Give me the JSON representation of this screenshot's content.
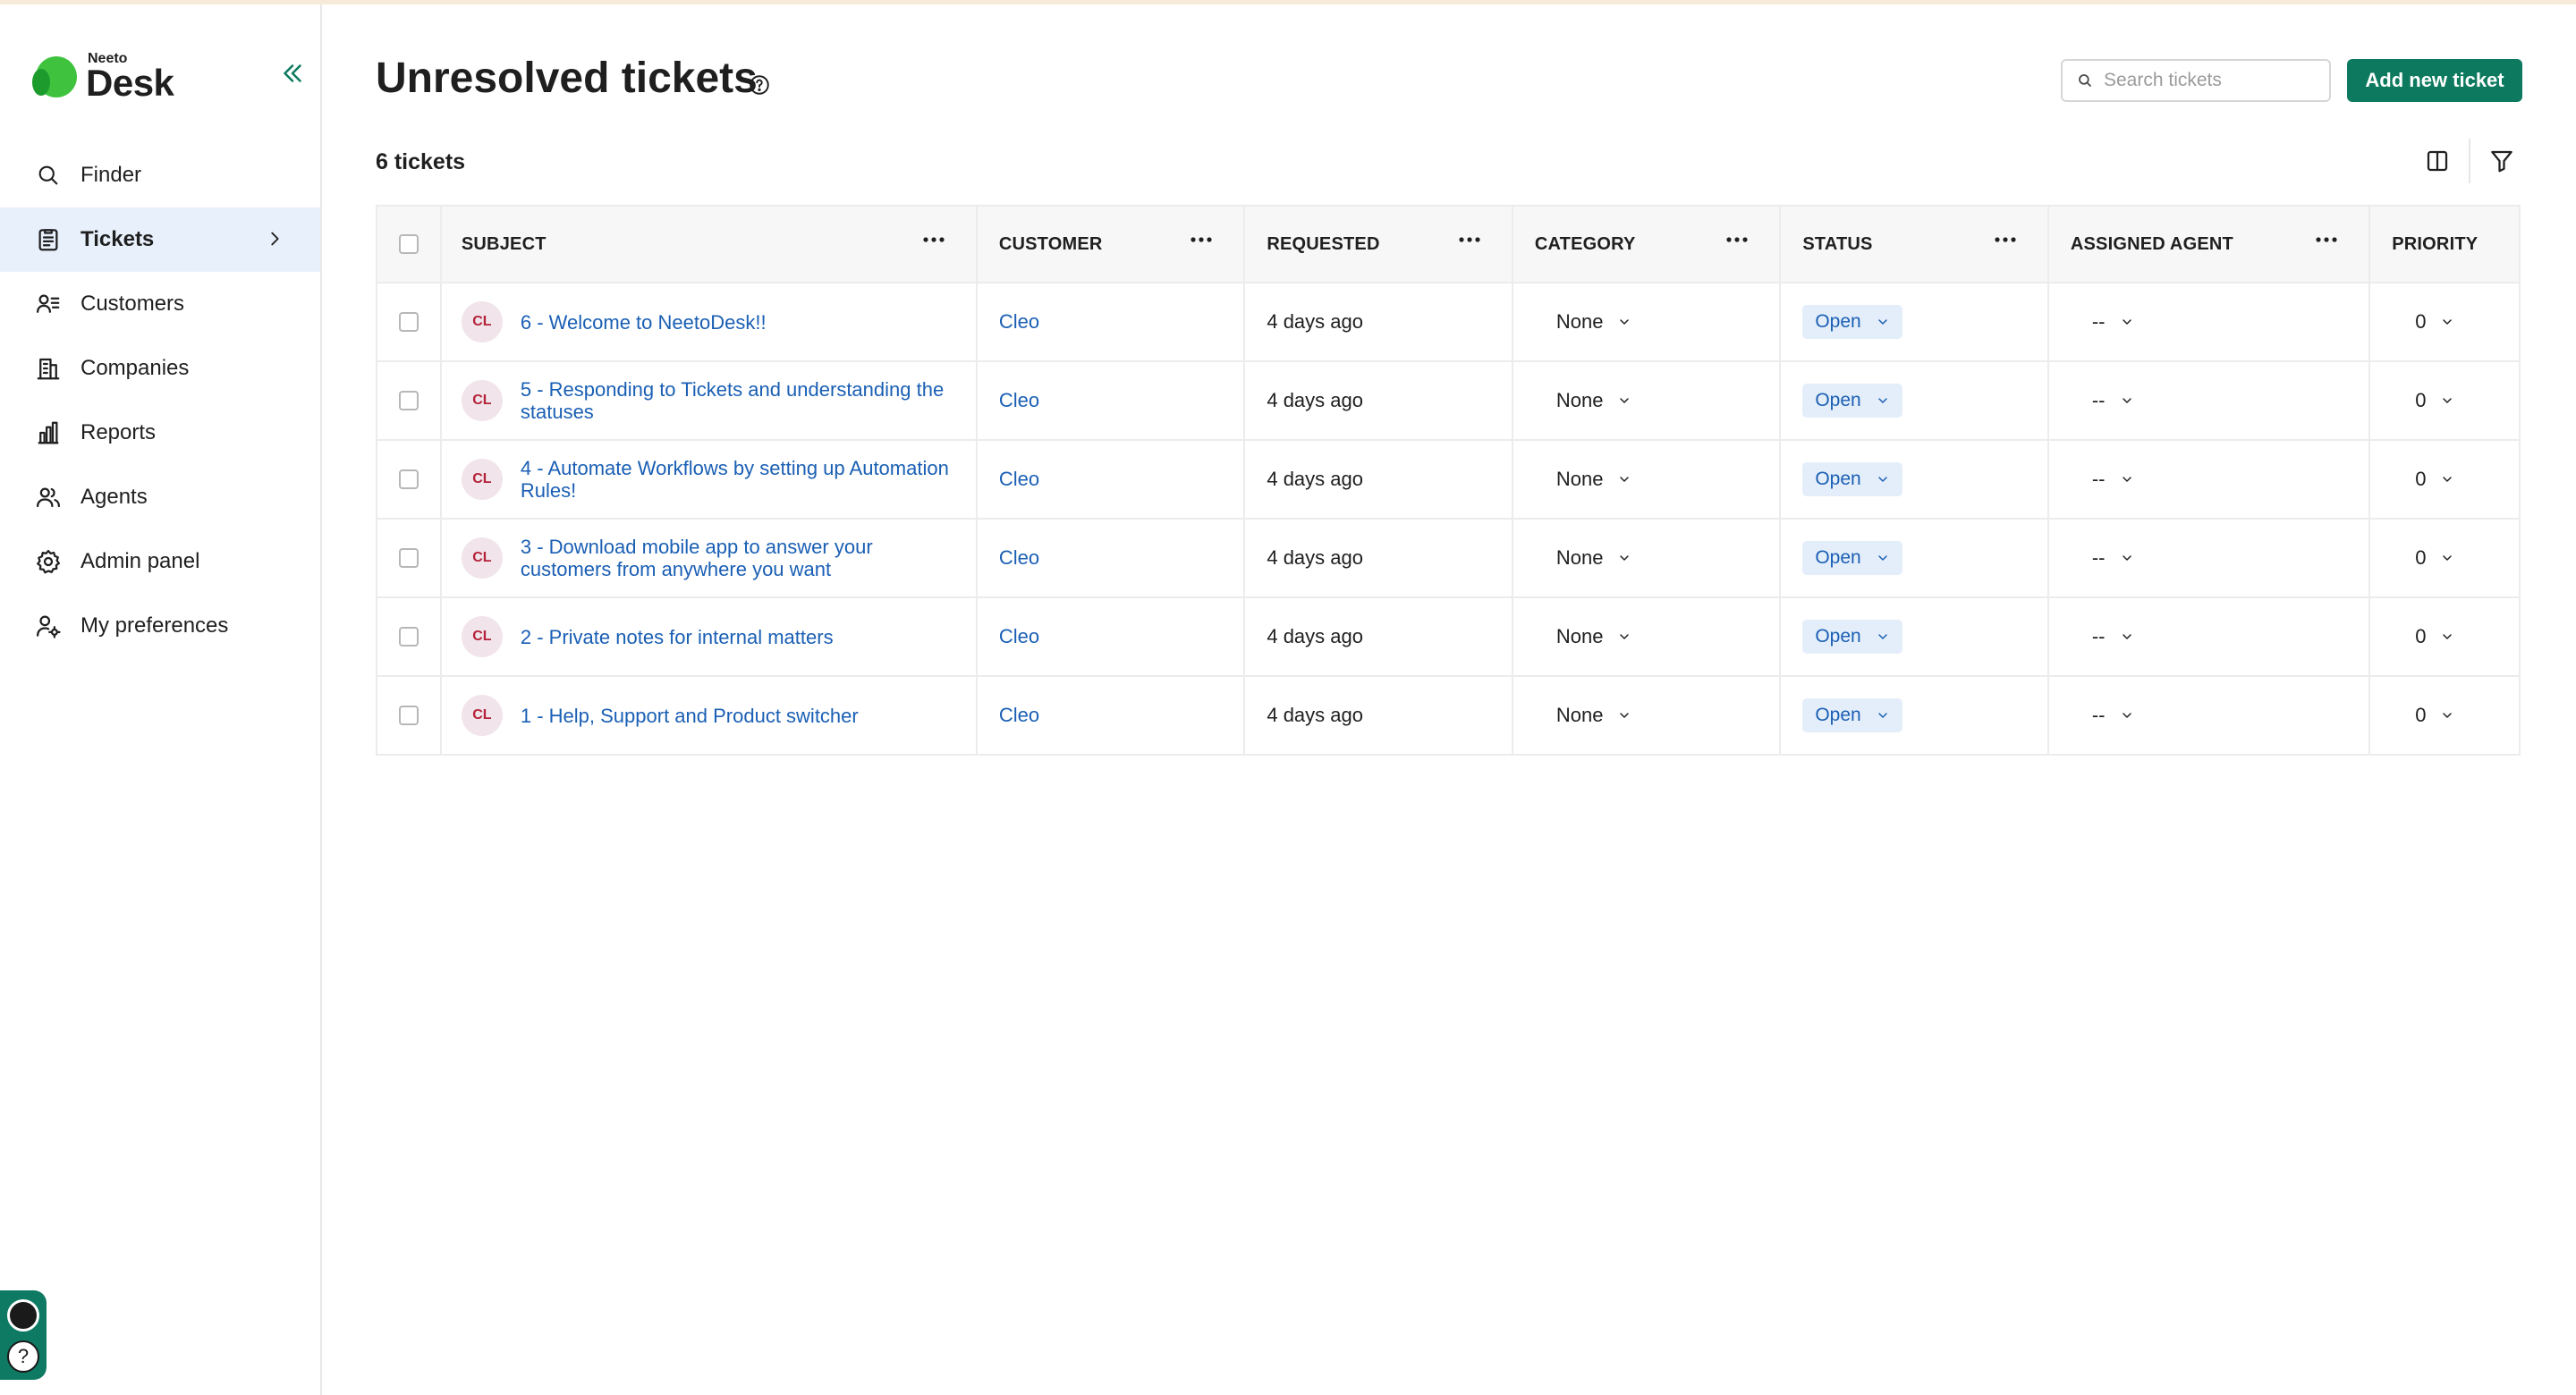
{
  "app": {
    "logo_small": "Neeto",
    "logo_big": "Desk"
  },
  "sidebar": {
    "items": [
      {
        "label": "Finder",
        "icon": "search-icon"
      },
      {
        "label": "Tickets",
        "icon": "clipboard-icon",
        "active": true
      },
      {
        "label": "Customers",
        "icon": "users-list-icon"
      },
      {
        "label": "Companies",
        "icon": "building-icon"
      },
      {
        "label": "Reports",
        "icon": "bar-chart-icon"
      },
      {
        "label": "Agents",
        "icon": "agents-icon"
      },
      {
        "label": "Admin panel",
        "icon": "gear-icon"
      },
      {
        "label": "My preferences",
        "icon": "user-gear-icon"
      }
    ]
  },
  "header": {
    "title": "Unresolved tickets",
    "search_placeholder": "Search tickets",
    "add_button": "Add new ticket",
    "count": "6 tickets"
  },
  "table": {
    "columns": [
      "SUBJECT",
      "CUSTOMER",
      "REQUESTED",
      "CATEGORY",
      "STATUS",
      "ASSIGNED AGENT",
      "PRIORITY"
    ],
    "rows": [
      {
        "avatar": "CL",
        "subject": "6 - Welcome to NeetoDesk!!",
        "customer": "Cleo",
        "requested": "4 days ago",
        "category": "None",
        "status": "Open",
        "agent": "--",
        "priority": "0"
      },
      {
        "avatar": "CL",
        "subject": "5 - Responding to Tickets and understanding the statuses",
        "customer": "Cleo",
        "requested": "4 days ago",
        "category": "None",
        "status": "Open",
        "agent": "--",
        "priority": "0"
      },
      {
        "avatar": "CL",
        "subject": "4 - Automate Workflows by setting up Automation Rules!",
        "customer": "Cleo",
        "requested": "4 days ago",
        "category": "None",
        "status": "Open",
        "agent": "--",
        "priority": "0"
      },
      {
        "avatar": "CL",
        "subject": "3 - Download mobile app to answer your customers from anywhere you want",
        "customer": "Cleo",
        "requested": "4 days ago",
        "category": "None",
        "status": "Open",
        "agent": "--",
        "priority": "0"
      },
      {
        "avatar": "CL",
        "subject": "2 - Private notes for internal matters",
        "customer": "Cleo",
        "requested": "4 days ago",
        "category": "None",
        "status": "Open",
        "agent": "--",
        "priority": "0"
      },
      {
        "avatar": "CL",
        "subject": "1 - Help, Support and Product switcher",
        "customer": "Cleo",
        "requested": "4 days ago",
        "category": "None",
        "status": "Open",
        "agent": "--",
        "priority": "0"
      }
    ]
  },
  "colors": {
    "accent": "#0d7a5f",
    "link": "#1a5fb4",
    "active_bg": "#e8f1fb",
    "badge_bg": "#e4eefa"
  }
}
